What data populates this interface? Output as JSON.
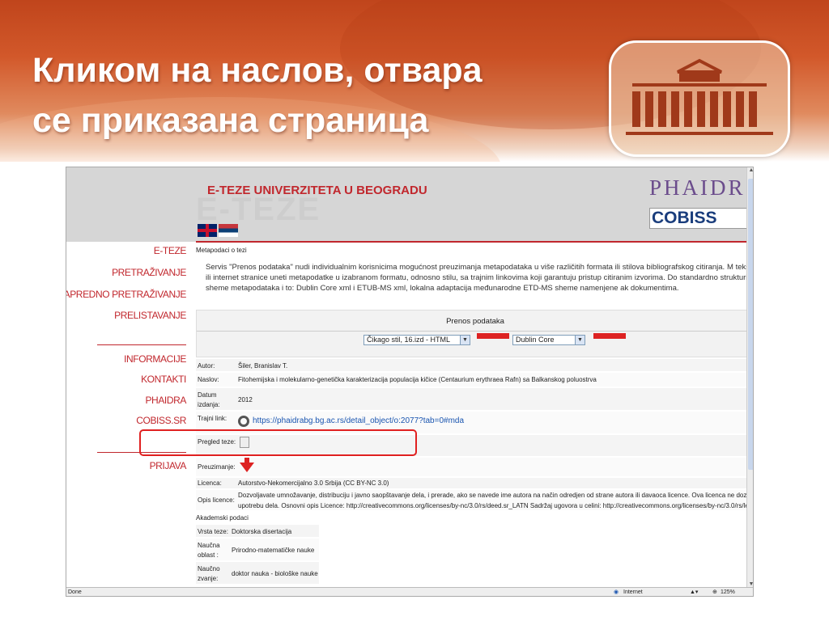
{
  "slide": {
    "title_line1": "Кликом на наслов, отвара",
    "title_line2": "се приказана страница"
  },
  "browser": {
    "banner_title": "E-TEZE UNIVERZITETA U BEOGRADU",
    "banner_bg_text": "E-TEZE",
    "phaidra_logo": "PHAIDR",
    "cobiss_logo": "COBISS",
    "status_left": "Done",
    "status_zone": "Internet",
    "status_zoom": "125%"
  },
  "sidebar": {
    "items": [
      {
        "label": "E-TEZE"
      },
      {
        "label": "PRETRAŽIVANJE"
      },
      {
        "label": "NAPREDNO PRETRAŽIVANJE"
      },
      {
        "label": "PRELISTAVANJE"
      },
      {
        "label": "INFORMACIJE"
      },
      {
        "label": "KONTAKTI"
      },
      {
        "label": "PHAIDRA"
      },
      {
        "label": "COBISS.SR"
      },
      {
        "label": "PRIJAVA"
      }
    ]
  },
  "content": {
    "meta_title": "Metapodaci o tezi",
    "intro": "Servis \"Prenos podataka\" nudi individualnim korisnicima mogućnost preuzimanja metapodataka u više različitih formata ili stilova bibliografskog citiranja. M tekstove ili internet stranice uneti metapodatke u izabranom formatu, odnosno stilu, sa trajnim linkovima koji garantuju pristup citiranim izvorima. Do standardno strukturisane sheme metapodataka i to: Dublin Core xml i ETUB-MS xml, lokalna adaptacija međunarodne ETD-MS sheme namenjene ak dokumentima.",
    "export_title": "Prenos podataka",
    "select_style": "Čikago stil, 16.izd - HTML",
    "select_schema": "Dublin Core",
    "rows": {
      "autor_k": "Autor:",
      "autor_v": "Šiler, Branislav T.",
      "naslov_k": "Naslov:",
      "naslov_v": "Fitohemijska i molekularno-genetička karakterizacija populacija kičice (Centaurium erythraea Rafn) sa Balkanskog poluostrva",
      "datum_k": "Datum izdanja:",
      "datum_v": "2012",
      "link_k": "Trajni link:",
      "link_v": "https://phaidrabg.bg.ac.rs/detail_object/o:2077?tab=0#mda",
      "pregled_k": "Pregled teze:",
      "preuz_k": "Preuzimanje:",
      "licenca_k": "Licenca:",
      "licenca_v": "Autorstvo-Nekomercijalno 3.0 Srbija (CC BY-NC 3.0)",
      "opis_k": "Opis licence:",
      "opis_v1": "Dozvoljavate umnožavanje, distribuciju i javno saopštavanje dela, i prerade, ako se navede ime autora na način odredjen od strane autora ili davaoca licence. Ova licenca ne dozvoljava ko",
      "opis_v2": "upotrebu dela. Osnovni opis Licence: http://creativecommons.org/licenses/by-nc/3.0/rs/deed.sr_LATN Sadržaj ugovora u celini: http://creativecommons.org/licenses/by-nc/3.0/rs/legalco"
    },
    "academic_title": "Akademski podaci",
    "academic": {
      "vrsta_k": "Vrsta teze:",
      "vrsta_v": "Doktorska disertacija",
      "oblast_k": "Naučna oblast :",
      "oblast_v": "Prirodno-matematičke nauke",
      "zvanje_k": "Naučno zvanje:",
      "zvanje_v": "doktor nauka - biološke nauke"
    }
  },
  "icons": [
    "flag-uk-icon",
    "flag-rs-icon",
    "link-chain-icon",
    "document-icon",
    "download-arrow-icon",
    "globe-icon"
  ],
  "colors": {
    "accent": "#c1272d",
    "header_orange": "#d2582a",
    "link": "#1a55b0",
    "highlight": "#e02020"
  }
}
